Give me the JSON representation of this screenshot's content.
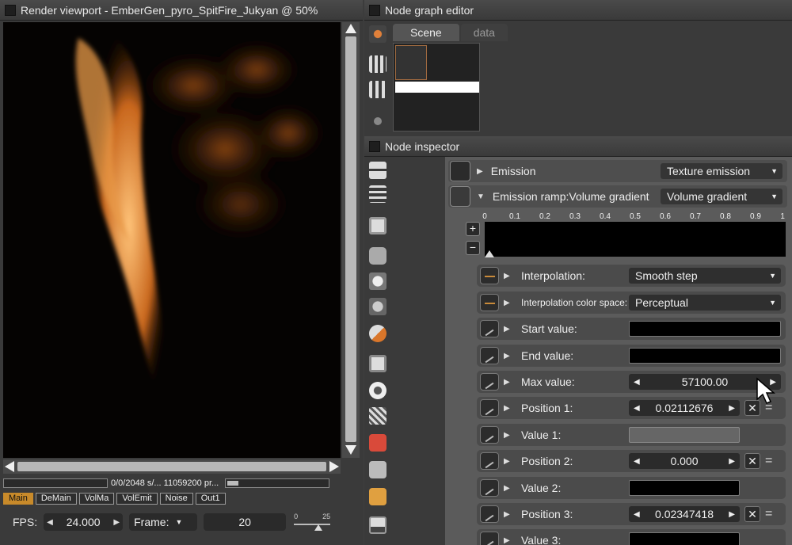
{
  "render_viewport": {
    "title": "Render viewport - EmberGen_pyro_SpitFire_Jukyan @ 50%",
    "status_text": "0/0/2048 s/... 11059200 pr...",
    "pass_tabs": [
      "Main",
      "DeMain",
      "VolMa",
      "VolEmit",
      "Noise",
      "Out1"
    ],
    "active_pass": "Main",
    "fps_label": "FPS:",
    "fps_value": "24.000",
    "frame_label": "Frame:",
    "frame_value": "20",
    "slider_min": "0",
    "slider_max": "25"
  },
  "node_graph": {
    "title": "Node graph editor",
    "tabs": [
      "Scene",
      "data"
    ]
  },
  "node_inspector": {
    "title": "Node inspector",
    "emission": {
      "label": "Emission",
      "value": "Texture emission"
    },
    "emission_ramp": {
      "label": "Emission ramp:Volume gradient",
      "value": "Volume gradient"
    },
    "ramp_ticks": [
      "0",
      "0.1",
      "0.2",
      "0.3",
      "0.4",
      "0.5",
      "0.6",
      "0.7",
      "0.8",
      "0.9",
      "1"
    ],
    "interpolation": {
      "label": "Interpolation:",
      "value": "Smooth step"
    },
    "interpolation_color_space": {
      "label": "Interpolation color space:",
      "value": "Perceptual"
    },
    "start_value": {
      "label": "Start value:"
    },
    "end_value": {
      "label": "End value:"
    },
    "max_value": {
      "label": "Max value:",
      "value": "57100.00"
    },
    "position_1": {
      "label": "Position 1:",
      "value": "0.02112676"
    },
    "value_1": {
      "label": "Value 1:"
    },
    "position_2": {
      "label": "Position 2:",
      "value": "0.000"
    },
    "value_2": {
      "label": "Value 2:"
    },
    "position_3": {
      "label": "Position 3:",
      "value": "0.02347418"
    },
    "value_3": {
      "label": "Value 3:"
    }
  },
  "colors": {
    "accent": "#c88a2a",
    "panel": "#3a3a3a",
    "inspector_bg": "#5b5b5b"
  }
}
